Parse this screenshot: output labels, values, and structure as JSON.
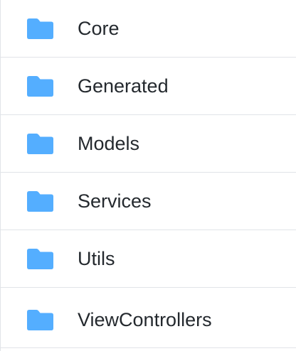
{
  "folder_list": {
    "icon": "folder-icon",
    "icon_color": "#54aeff",
    "items": [
      {
        "label": "Core"
      },
      {
        "label": "Generated"
      },
      {
        "label": "Models"
      },
      {
        "label": "Services"
      },
      {
        "label": "Utils"
      },
      {
        "label": "ViewControllers"
      }
    ]
  }
}
